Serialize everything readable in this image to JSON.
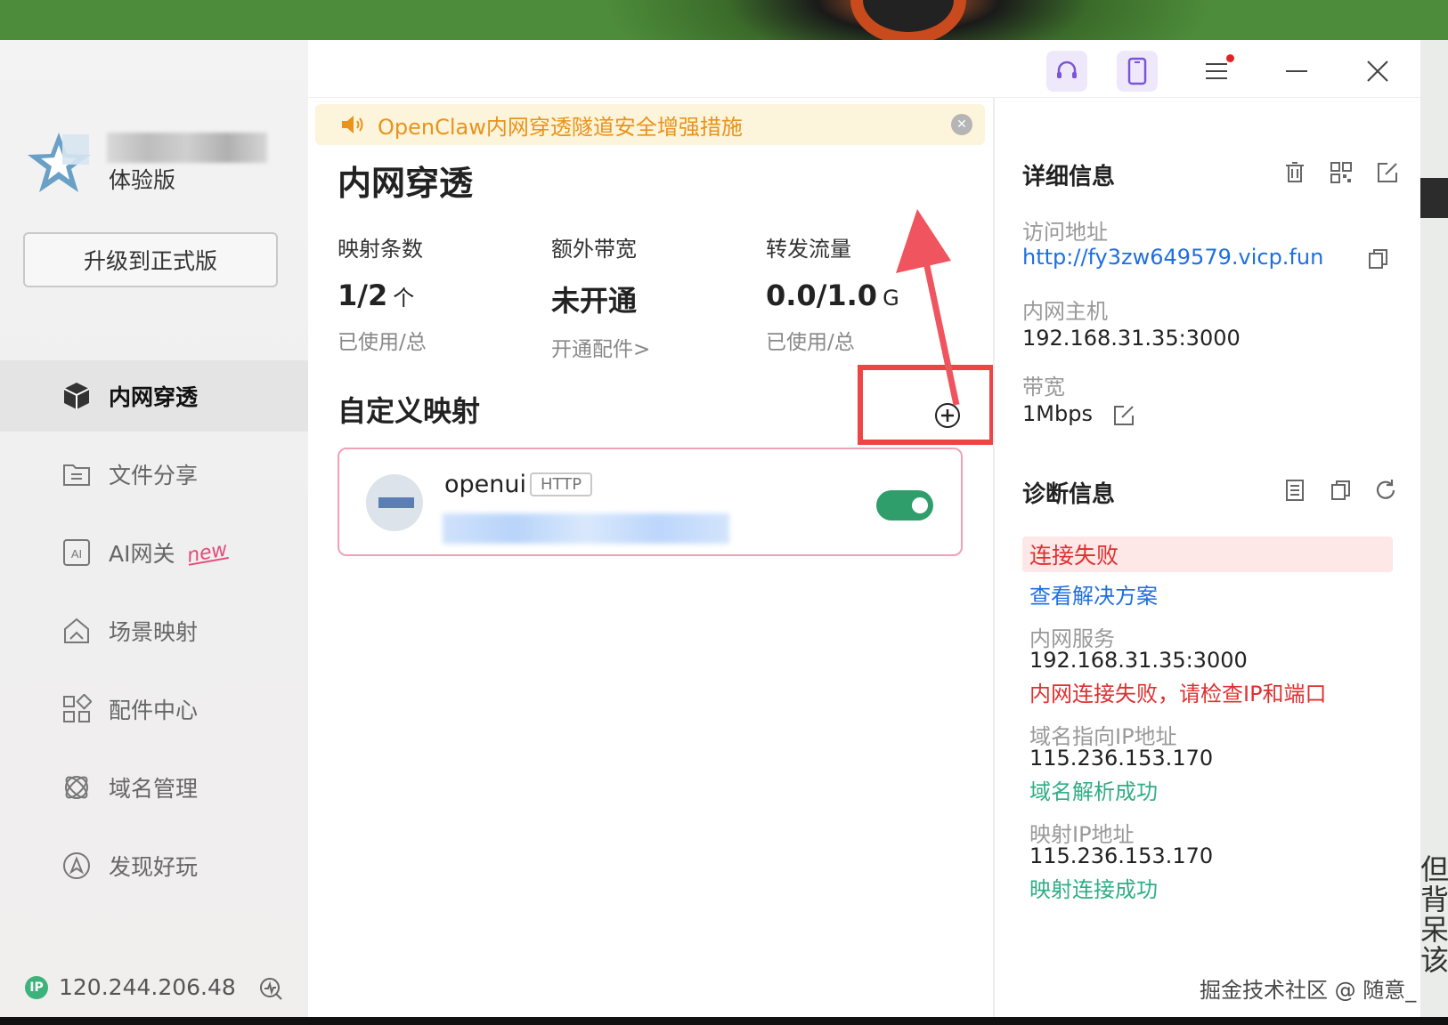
{
  "sidebar": {
    "edition": "体验版",
    "upgrade_label": "升级到正式版",
    "items": [
      {
        "label": "内网穿透",
        "icon": "cube-icon"
      },
      {
        "label": "文件分享",
        "icon": "folder-icon"
      },
      {
        "label": "AI网关",
        "icon": "ai-icon",
        "badge": "new"
      },
      {
        "label": "场景映射",
        "icon": "house-icon"
      },
      {
        "label": "配件中心",
        "icon": "grid-icon"
      },
      {
        "label": "域名管理",
        "icon": "globe-icon"
      },
      {
        "label": "发现好玩",
        "icon": "compass-icon"
      }
    ],
    "ip": "120.244.206.48",
    "ip_badge": "IP"
  },
  "notice": {
    "text": "OpenClaw内网穿透隧道安全增强措施"
  },
  "main": {
    "title": "内网穿透",
    "stats": [
      {
        "label": "映射条数",
        "value": "1/2",
        "unit": "个",
        "sub": "已使用/总"
      },
      {
        "label": "额外带宽",
        "value": "未开通",
        "unit": "",
        "sub": "开通配件>"
      },
      {
        "label": "转发流量",
        "value": "0.0/1.0",
        "unit": "G",
        "sub": "已使用/总"
      }
    ],
    "custom_title": "自定义映射",
    "mapping": {
      "name": "openui",
      "protocol": "HTTP",
      "enabled": true
    }
  },
  "detail": {
    "title": "详细信息",
    "access_label": "访问地址",
    "access_url": "http://fy3zw649579.vicp.fun",
    "host_label": "内网主机",
    "host_value": "192.168.31.35:3000",
    "bandwidth_label": "带宽",
    "bandwidth_value": "1Mbps"
  },
  "diagnosis": {
    "title": "诊断信息",
    "status": "连接失败",
    "solution_link": "查看解决方案",
    "service_label": "内网服务",
    "service_value": "192.168.31.35:3000",
    "service_error": "内网连接失败，请检查IP和端口",
    "domain_label": "域名指向IP地址",
    "domain_value": "115.236.153.170",
    "domain_ok": "域名解析成功",
    "map_label": "映射IP地址",
    "map_value": "115.236.153.170",
    "map_ok": "映射连接成功"
  },
  "watermark": "掘金技术社区 @ 随意_",
  "side_text": "但\n背\n呆\n该",
  "colors": {
    "accent": "#2f9e6a",
    "link": "#1e6fe0",
    "error": "#e02f2f",
    "success": "#2fae82",
    "notice": "#e8931b",
    "annotation": "#ee4444"
  }
}
